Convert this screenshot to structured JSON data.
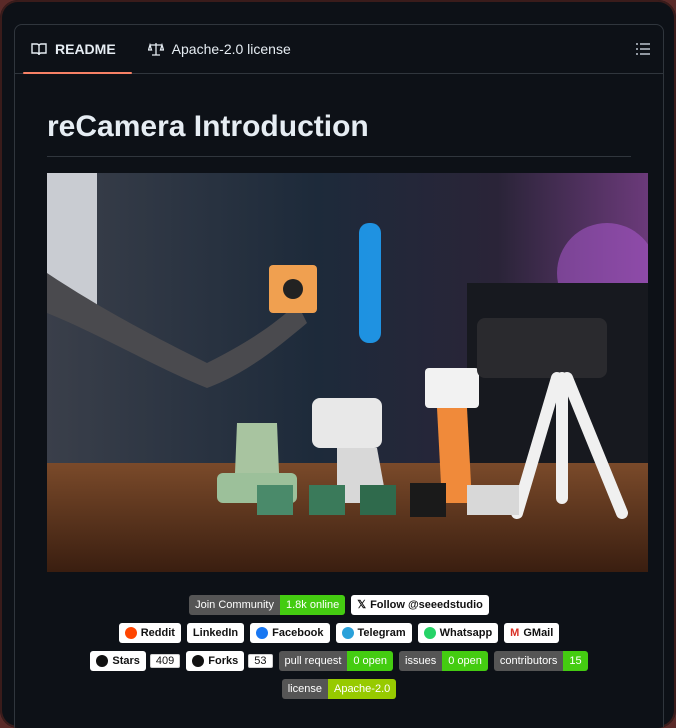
{
  "tabs": {
    "readme": "README",
    "license": "Apache-2.0 license"
  },
  "title": "reCamera Introduction",
  "badges": {
    "join_left": "Join Community",
    "join_right": "1.8k online",
    "follow": "Follow @seeedstudio",
    "reddit": "Reddit",
    "linkedin": "LinkedIn",
    "facebook": "Facebook",
    "telegram": "Telegram",
    "whatsapp": "Whatsapp",
    "gmail": "GMail",
    "stars": "Stars",
    "stars_count": "409",
    "forks": "Forks",
    "forks_count": "53",
    "pr_left": "pull request",
    "pr_right": "0 open",
    "issues_left": "issues",
    "issues_right": "0 open",
    "contrib_left": "contributors",
    "contrib_right": "15",
    "license_left": "license",
    "license_right": "Apache-2.0"
  },
  "colors": {
    "green": "#4c1",
    "lime": "#97ca00",
    "accent": "#f78166"
  }
}
